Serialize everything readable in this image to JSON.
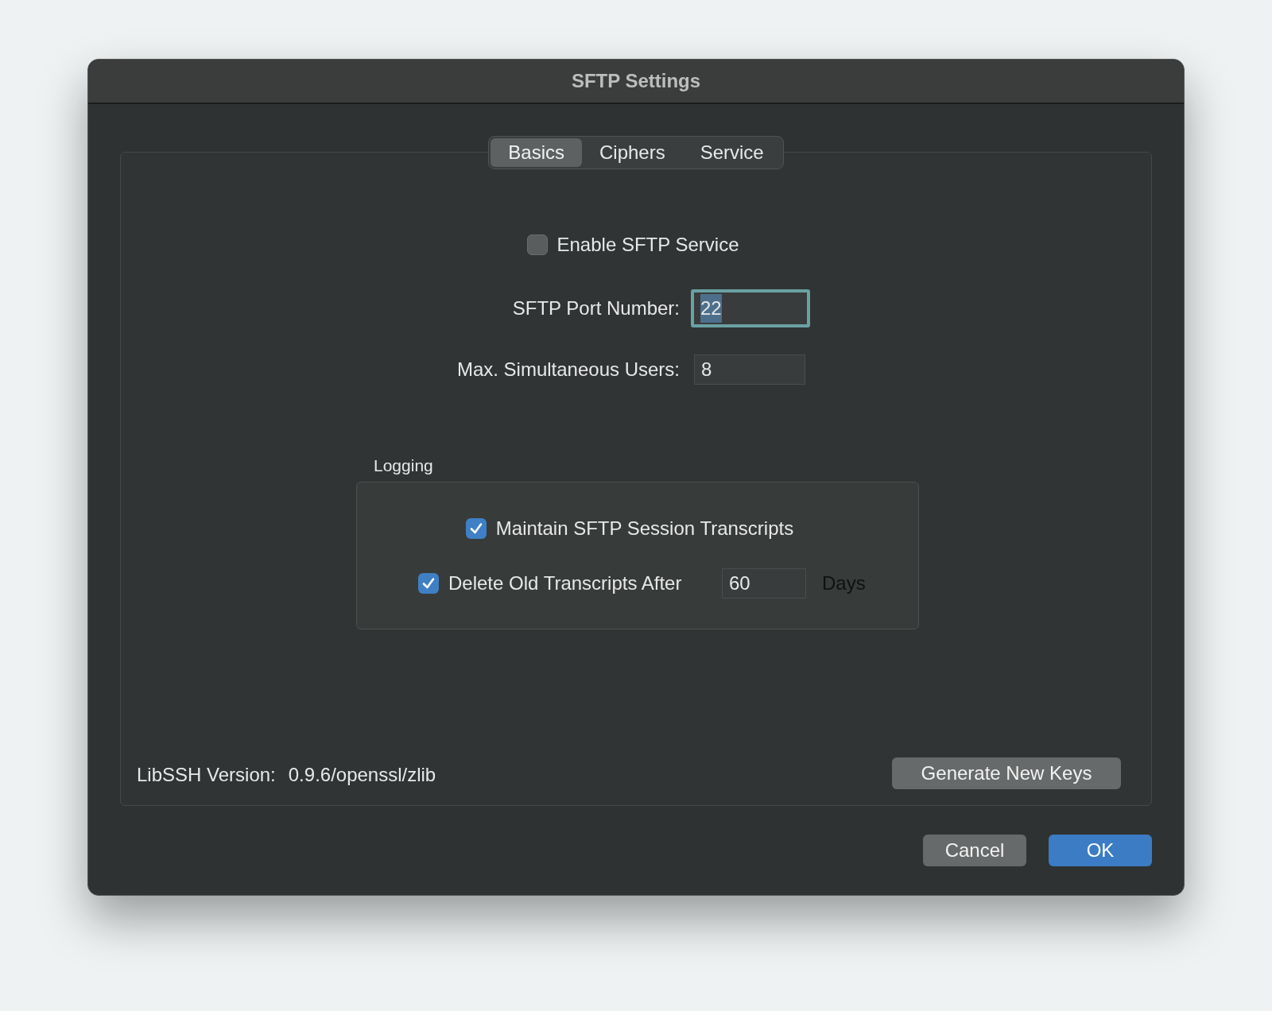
{
  "window": {
    "title": "SFTP Settings"
  },
  "tabs": [
    {
      "label": "Basics",
      "selected": true
    },
    {
      "label": "Ciphers",
      "selected": false
    },
    {
      "label": "Service",
      "selected": false
    }
  ],
  "enable_service": {
    "label": "Enable SFTP Service",
    "checked": false
  },
  "fields": [
    {
      "label": "SFTP Port Number:",
      "value": "22",
      "focused": true
    },
    {
      "label": "Max. Simultaneous Users:",
      "value": "8",
      "focused": false
    }
  ],
  "logging": {
    "title": "Logging",
    "maintain": {
      "label": "Maintain SFTP Session Transcripts",
      "checked": true
    },
    "delete_old": {
      "label": "Delete Old Transcripts After",
      "checked": true,
      "value": "60",
      "unit": "Days"
    }
  },
  "version": {
    "label": "LibSSH Version:",
    "value": "0.9.6/openssl/zlib"
  },
  "generate_button": "Generate New Keys",
  "buttons": [
    {
      "label": "Cancel",
      "kind": "secondary"
    },
    {
      "label": "OK",
      "kind": "primary"
    }
  ]
}
